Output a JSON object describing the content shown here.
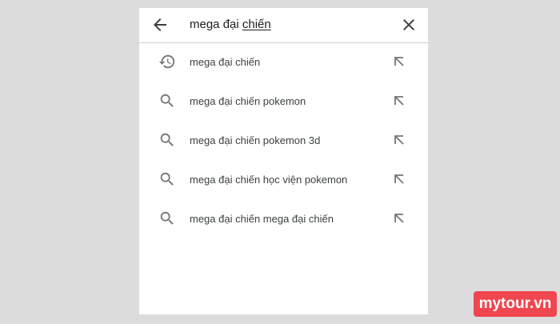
{
  "search": {
    "query_prefix": "mega đại ",
    "query_underlined": "chiến"
  },
  "suggestions": [
    {
      "label": "mega đại chiến",
      "icon": "history-icon"
    },
    {
      "label": "mega đại chiến pokemon",
      "icon": "search-icon"
    },
    {
      "label": "mega đại chiến pokemon 3d",
      "icon": "search-icon"
    },
    {
      "label": "mega đại chiến học viện pokemon",
      "icon": "search-icon"
    },
    {
      "label": "mega đại chiến mega đại chiến",
      "icon": "search-icon"
    }
  ],
  "icons": {
    "back": "arrow-left-icon",
    "clear": "close-icon",
    "fill": "arrow-up-left-icon"
  },
  "watermark": {
    "text": "mytour.vn",
    "color": "#f0464f"
  }
}
